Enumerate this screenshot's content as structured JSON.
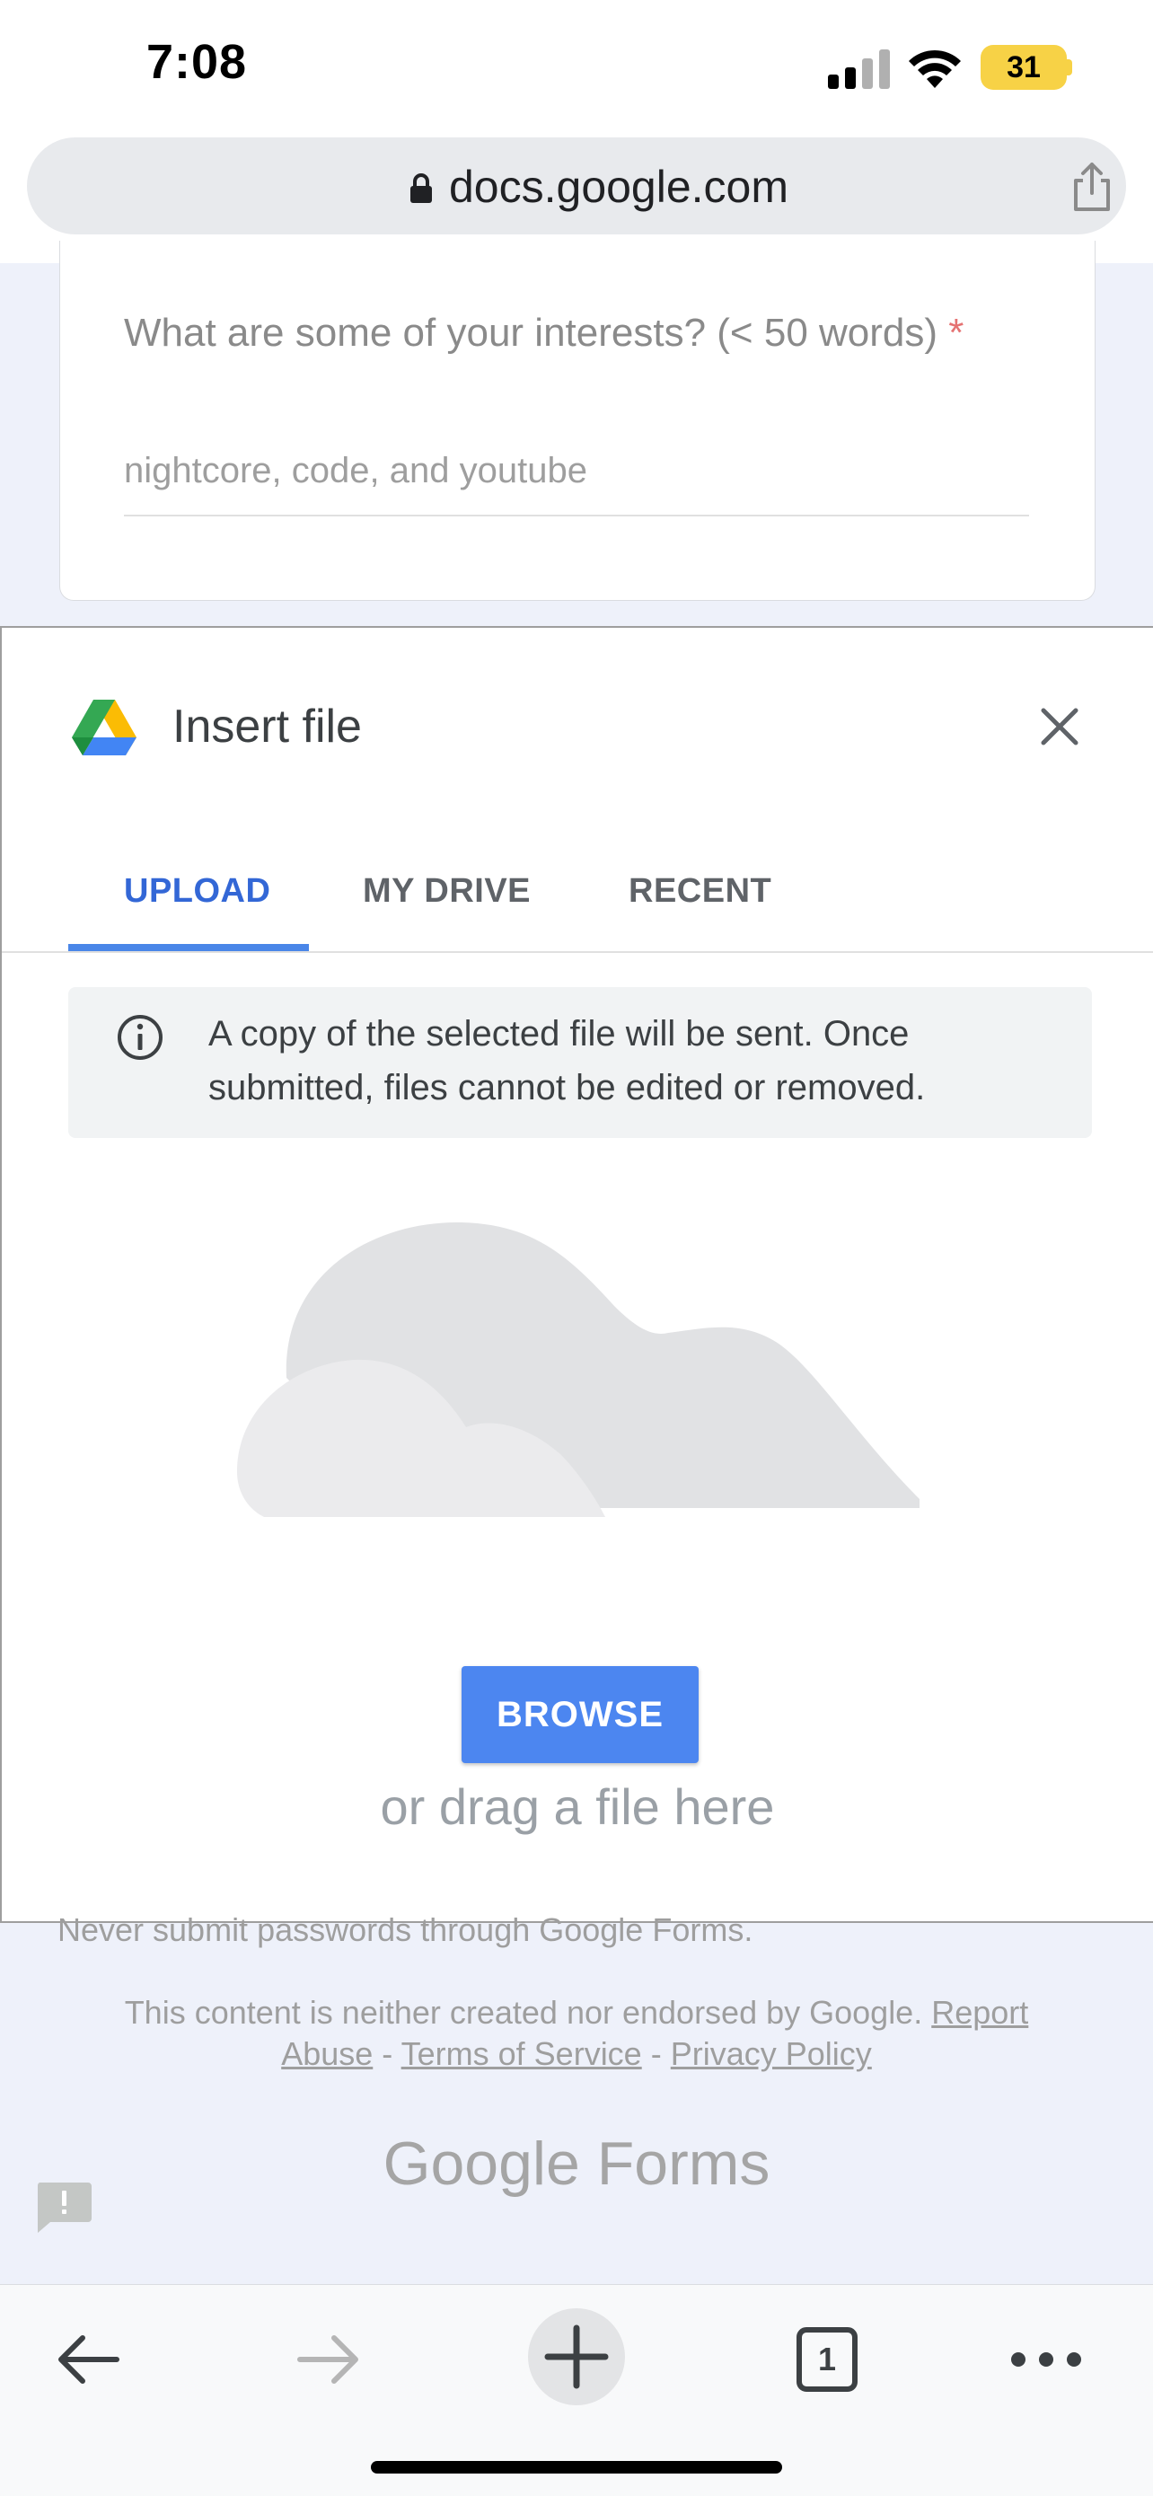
{
  "status_bar": {
    "time": "7:08",
    "battery": "31"
  },
  "browser": {
    "url": "docs.google.com",
    "open_tabs": "1"
  },
  "form": {
    "question": "What are some of your interests? (< 50 words)",
    "required_marker": "*",
    "answer": "nightcore, code, and youtube",
    "password_warning": "Never submit passwords through Google Forms.",
    "footer_disclaimer": "This content is neither created nor endorsed by Google.",
    "footer_links": {
      "report_abuse": "Report Abuse",
      "terms": "Terms of Service",
      "privacy": "Privacy Policy"
    },
    "footer_separator": "-",
    "logo_google": "Google",
    "logo_forms": "Forms"
  },
  "dialog": {
    "title": "Insert file",
    "tabs": [
      {
        "label": "UPLOAD",
        "active": true
      },
      {
        "label": "MY DRIVE",
        "active": false
      },
      {
        "label": "RECENT",
        "active": false
      }
    ],
    "notice": "A copy of the selected file will be sent. Once submitted, files cannot be edited or removed.",
    "browse_label": "BROWSE",
    "drag_text": "or drag a file here"
  },
  "icons": {
    "lock": "lock-icon",
    "share": "share-icon",
    "drive": "google-drive-icon",
    "close": "close-icon",
    "info": "info-icon",
    "cloud": "cloud-illustration",
    "feedback": "feedback-icon",
    "back": "back-arrow-icon",
    "forward": "forward-arrow-icon",
    "new_tab": "plus-icon",
    "tabs": "tabs-icon",
    "more": "more-icon"
  },
  "colors": {
    "accent": "#4a86e8",
    "active_tab": "#3367d6",
    "battery": "#f7d246",
    "required": "#e57373"
  }
}
